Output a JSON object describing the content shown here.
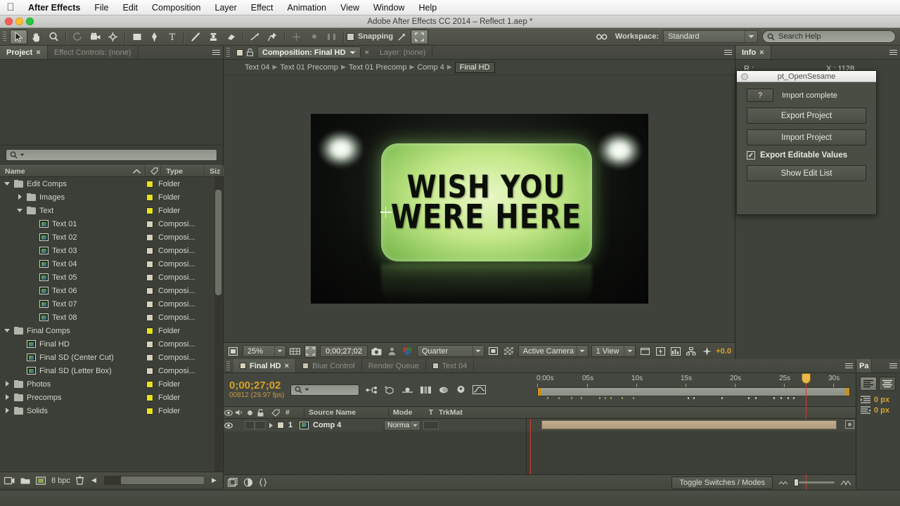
{
  "mac_menu": {
    "apple": "apple-logo",
    "items": [
      "After Effects",
      "File",
      "Edit",
      "Composition",
      "Layer",
      "Effect",
      "Animation",
      "View",
      "Window",
      "Help"
    ]
  },
  "window": {
    "title": "Adobe After Effects CC 2014 – Reflect 1.aep *"
  },
  "toolbar": {
    "tools": [
      {
        "name": "selection-tool",
        "glyph": "arrow",
        "active": true
      },
      {
        "name": "hand-tool",
        "glyph": "hand",
        "active": false
      },
      {
        "name": "zoom-tool",
        "glyph": "magnifier",
        "active": false
      },
      {
        "name": "rotation-tool",
        "glyph": "rotate",
        "active": false
      },
      {
        "name": "camera-tool",
        "glyph": "camera",
        "active": false
      },
      {
        "name": "pan-behind-tool",
        "glyph": "anchor-point",
        "active": false
      },
      {
        "name": "shape-tool",
        "glyph": "rectangle",
        "active": false
      },
      {
        "name": "pen-tool",
        "glyph": "pen",
        "active": false
      },
      {
        "name": "type-tool",
        "glyph": "type-T",
        "active": false
      },
      {
        "name": "brush-tool",
        "glyph": "brush",
        "active": false
      },
      {
        "name": "clone-stamp-tool",
        "glyph": "stamp",
        "active": false
      },
      {
        "name": "eraser-tool",
        "glyph": "eraser",
        "active": false
      },
      {
        "name": "roto-brush-tool",
        "glyph": "roto-brush",
        "active": false
      },
      {
        "name": "puppet-pin-tool",
        "glyph": "pushpin",
        "active": false
      }
    ],
    "snapping_label": "Snapping",
    "snapping_checked": false,
    "workspace_label": "Workspace:",
    "workspace_value": "Standard",
    "search_help_placeholder": "Search Help"
  },
  "project_panel": {
    "tabs": [
      {
        "label": "Project",
        "selected": true,
        "closable": true
      },
      {
        "label": "Effect Controls: (none)",
        "selected": false,
        "closable": false
      }
    ],
    "search_placeholder": "",
    "columns": [
      "Name",
      "Type",
      "Siz"
    ],
    "items": [
      {
        "label": "Edit Comps",
        "type": "Folder",
        "kind": "folder",
        "indent": 0,
        "twirl": "down",
        "swatch": "yellow"
      },
      {
        "label": "Images",
        "type": "Folder",
        "kind": "folder",
        "indent": 1,
        "twirl": "right",
        "swatch": "yellow"
      },
      {
        "label": "Text",
        "type": "Folder",
        "kind": "folder",
        "indent": 1,
        "twirl": "down",
        "swatch": "yellow"
      },
      {
        "label": "Text 01",
        "type": "Composi...",
        "kind": "comp",
        "indent": 2,
        "twirl": "none",
        "swatch": "tan"
      },
      {
        "label": "Text 02",
        "type": "Composi...",
        "kind": "comp",
        "indent": 2,
        "twirl": "none",
        "swatch": "tan"
      },
      {
        "label": "Text 03",
        "type": "Composi...",
        "kind": "comp",
        "indent": 2,
        "twirl": "none",
        "swatch": "tan"
      },
      {
        "label": "Text 04",
        "type": "Composi...",
        "kind": "comp",
        "indent": 2,
        "twirl": "none",
        "swatch": "tan"
      },
      {
        "label": "Text 05",
        "type": "Composi...",
        "kind": "comp",
        "indent": 2,
        "twirl": "none",
        "swatch": "tan"
      },
      {
        "label": "Text 06",
        "type": "Composi...",
        "kind": "comp",
        "indent": 2,
        "twirl": "none",
        "swatch": "tan"
      },
      {
        "label": "Text 07",
        "type": "Composi...",
        "kind": "comp",
        "indent": 2,
        "twirl": "none",
        "swatch": "tan"
      },
      {
        "label": "Text 08",
        "type": "Composi...",
        "kind": "comp",
        "indent": 2,
        "twirl": "none",
        "swatch": "tan"
      },
      {
        "label": "Final Comps",
        "type": "Folder",
        "kind": "folder",
        "indent": 0,
        "twirl": "down",
        "swatch": "yellow"
      },
      {
        "label": "Final HD",
        "type": "Composi...",
        "kind": "comp",
        "indent": 1,
        "twirl": "none",
        "swatch": "tan"
      },
      {
        "label": "Final SD (Center Cut)",
        "type": "Composi...",
        "kind": "comp",
        "indent": 1,
        "twirl": "none",
        "swatch": "tan"
      },
      {
        "label": "Final SD (Letter Box)",
        "type": "Composi...",
        "kind": "comp",
        "indent": 1,
        "twirl": "none",
        "swatch": "tan"
      },
      {
        "label": "Photos",
        "type": "Folder",
        "kind": "folder",
        "indent": 0,
        "twirl": "right",
        "swatch": "yellow"
      },
      {
        "label": "Precomps",
        "type": "Folder",
        "kind": "folder",
        "indent": 0,
        "twirl": "right",
        "swatch": "yellow"
      },
      {
        "label": "Solids",
        "type": "Folder",
        "kind": "folder",
        "indent": 0,
        "twirl": "right",
        "swatch": "yellow"
      }
    ],
    "status_bpc": "8 bpc"
  },
  "comp_panel": {
    "tabs": [
      {
        "label": "Composition: Final HD",
        "selected": true
      },
      {
        "label": "Layer: (none)",
        "selected": false
      }
    ],
    "breadcrumb": [
      "Text 04",
      "Text 01 Precomp",
      "Text 01 Precomp",
      "Comp 4",
      "Final HD"
    ],
    "breadcrumb_current": "Final HD",
    "stage": {
      "line1": "WISH YOU",
      "line2": "WERE HERE"
    },
    "controls": {
      "magnification": "25%",
      "timecode": "0;00;27;02",
      "resolution": "Quarter",
      "camera": "Active Camera",
      "views": "1 View",
      "exposure": "+0.0"
    }
  },
  "info_panel": {
    "tab": "Info",
    "rows": [
      {
        "left": "R :",
        "right": "X : 1128"
      }
    ]
  },
  "sesame": {
    "title": "pt_OpenSesame",
    "question_label": "?",
    "status": "Import complete",
    "export_project": "Export Project",
    "import_project": "Import Project",
    "checkbox_label": "Export Editable Values",
    "checkbox_checked": true,
    "show_edit_list": "Show Edit List"
  },
  "timeline": {
    "tabs": [
      {
        "label": "Final HD",
        "selected": true,
        "closable": true,
        "swatch": true
      },
      {
        "label": "Blue Control",
        "selected": false,
        "closable": false,
        "swatch": true
      },
      {
        "label": "Render Queue",
        "selected": false,
        "closable": false,
        "swatch": false
      },
      {
        "label": "Text 04",
        "selected": false,
        "closable": false,
        "swatch": true
      }
    ],
    "timecode": "0;00;27;02",
    "frames_fps": "00812 (29.97 fps)",
    "search_placeholder": "",
    "ruler_labels": [
      "0:00s",
      "05s",
      "10s",
      "15s",
      "20s",
      "25s",
      "30s"
    ],
    "playhead_time_label": "0;00;27;02",
    "columns": [
      "#",
      "Source Name",
      "Mode",
      "T",
      "TrkMat"
    ],
    "layers": [
      {
        "index": "1",
        "source_name": "Comp 4",
        "mode": "Normal",
        "visible": true
      }
    ],
    "toggle_label": "Toggle Switches / Modes"
  },
  "paragraph_panel": {
    "tab": "Pa",
    "indent_left": "0 px",
    "indent_right": "0 px"
  }
}
